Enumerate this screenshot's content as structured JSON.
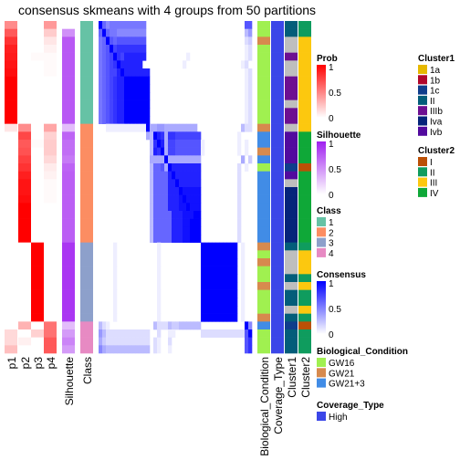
{
  "title": "consensus skmeans with 4 groups from 50 partitions",
  "chart_data": {
    "type": "heatmap",
    "title": "consensus skmeans with 4 groups from 50 partitions",
    "n_samples": 42,
    "consensus_scale": "0-15 hex digit per cell (value = digit/15)",
    "consensus_matrix": [
      "f978888888888000000000000000000000000000aab",
      "9f9887777777700000000000000000000000000046",
      "89fa9aaaaaaaa00000000000000000000000000023",
      "89afbcccccccc00000000000000000000000000012",
      "89abfcbdddddd00000000000100000000000000012",
      "89abcfdddddd00000000000100000000000000012",
      "89abbdfddddddd0000000000000000000000000012",
      "89abcddfffffff0000000000000000000000000012",
      "89abcddfffffff0000000000000000000000000012",
      "89abcddfffffff0000000000000000000000000012",
      "89abcddfffffff0000000000000000000000000012",
      "89abcddfffffff0000000000000000000000000012",
      "89abcddfffffff0000000000000000000000000012",
      "0011111111111f5566555555555000000000000422",
      "000000000000054fdc5ccbbbbbbb00000000001000",
      "000000000000004cfd5bbaaaaaaa10000000001010",
      "000000000000004dcf5bbaaaaaaa10000000001010",
      "000000000000005555f555555555000000000005033",
      "00000000000000499a5fdddddddd00000000002010",
      "0000000000000049999dfddddddd00000000002000",
      "0000000000000049999ddfdddddd00000000002000",
      "0000000000000049999dddfeeeee00000000002000",
      "0000000000000049999dddefeeee00000000002000",
      "0000000000000049999dddeefeee00000000002000",
      "00000000000000499999dddeeeff00000000002000",
      "00000000000000499999dddeefff00000000002000",
      "00000000000000499999dddeefff00000000002000",
      "00000000000000499999dddeefff00000000002000",
      "0000100000000000100000000000ffffffffff0100",
      "0000100000000000100000000000ffffffffff0100",
      "0000100000000000100000000000ffffffffff0100",
      "0000100000000000100000000000ffffffffff0100",
      "0000100000000000100000000000ffffffffff0100",
      "0000100000000000100000000000ffffffffff0100",
      "0000100000000000100000000000ffffffffff0100",
      "0000100000000000100000000000ffffffffff0100",
      "0000100000000000100000000000ffffffffff0100",
      "0000100000000000100000000000ffffffffff0100",
      "4210000000000004222433444444000000000000f799",
      "6422222222222200200110000000222222222222afbb",
      "5322222222222202100200000000000000000000acfc",
      "7544444444444402100100000000000000000000accf"
    ],
    "prob": {
      "columns": [
        "p1",
        "p2",
        "p3",
        "p4"
      ],
      "values": [
        [
          0.45,
          0,
          0,
          0.4
        ],
        [
          0.65,
          0,
          0,
          0.2
        ],
        [
          0.8,
          0,
          0,
          0.1
        ],
        [
          0.88,
          0,
          0,
          0.05
        ],
        [
          0.9,
          0,
          0.02,
          0.02
        ],
        [
          0.92,
          0,
          0,
          0.02
        ],
        [
          0.95,
          0,
          0,
          0.02
        ],
        [
          1,
          0,
          0,
          0
        ],
        [
          1,
          0,
          0,
          0
        ],
        [
          1,
          0,
          0,
          0
        ],
        [
          1,
          0,
          0,
          0
        ],
        [
          1,
          0,
          0,
          0
        ],
        [
          1,
          0,
          0,
          0
        ],
        [
          0.1,
          0.45,
          0,
          0.35
        ],
        [
          0,
          0.72,
          0,
          0.18
        ],
        [
          0,
          0.65,
          0.02,
          0.2
        ],
        [
          0,
          0.68,
          0,
          0.2
        ],
        [
          0,
          0.75,
          0,
          0.15
        ],
        [
          0,
          0.8,
          0,
          0.08
        ],
        [
          0,
          0.88,
          0,
          0.05
        ],
        [
          0,
          0.92,
          0,
          0.02
        ],
        [
          0,
          0.92,
          0,
          0.02
        ],
        [
          0,
          0.95,
          0,
          0.02
        ],
        [
          0,
          1,
          0,
          0
        ],
        [
          0,
          1,
          0,
          0
        ],
        [
          0,
          1,
          0,
          0
        ],
        [
          0,
          1,
          0,
          0
        ],
        [
          0,
          1,
          0,
          0
        ],
        [
          0,
          0,
          1,
          0
        ],
        [
          0,
          0,
          1,
          0
        ],
        [
          0,
          0,
          1,
          0
        ],
        [
          0,
          0,
          1,
          0
        ],
        [
          0,
          0,
          1,
          0
        ],
        [
          0,
          0,
          1,
          0
        ],
        [
          0,
          0,
          1,
          0
        ],
        [
          0,
          0,
          1,
          0
        ],
        [
          0,
          0,
          1,
          0
        ],
        [
          0,
          0,
          1,
          0
        ],
        [
          0,
          0.3,
          0,
          0.55
        ],
        [
          0.15,
          0,
          0.18,
          0.55
        ],
        [
          0.15,
          0.06,
          0,
          0.65
        ],
        [
          0.25,
          0,
          0,
          0.65
        ]
      ]
    },
    "silhouette": [
      0,
      0.5,
      0.75,
      0.75,
      0.75,
      0.75,
      0.75,
      0.75,
      0.75,
      0.75,
      0.75,
      0.75,
      0.75,
      0.3,
      0.7,
      0.65,
      0.65,
      0.6,
      0.7,
      0.72,
      0.72,
      0.72,
      0.72,
      0.72,
      0.72,
      0.72,
      0.72,
      0.72,
      0.9,
      0.9,
      0.9,
      0.9,
      0.9,
      0.9,
      0.9,
      0.9,
      0.9,
      0.9,
      0.3,
      0.45,
      0.55,
      0.45
    ],
    "class": [
      1,
      1,
      1,
      1,
      1,
      1,
      1,
      1,
      1,
      1,
      1,
      1,
      1,
      2,
      2,
      2,
      2,
      2,
      2,
      2,
      2,
      2,
      2,
      2,
      2,
      2,
      2,
      2,
      3,
      3,
      3,
      3,
      3,
      3,
      3,
      3,
      3,
      3,
      4,
      4,
      4,
      4
    ],
    "biological_condition": [
      "GW16",
      "GW16",
      "GW21",
      "GW16",
      "GW16",
      "GW16",
      "GW16",
      "GW16",
      "GW16",
      "GW16",
      "GW16",
      "GW16",
      "GW16",
      "GW21",
      "GW21+3",
      "GW21+3",
      "GW21",
      "GW21+3",
      "GW16",
      "GW21+3",
      "GW21+3",
      "GW21+3",
      "GW21+3",
      "GW21+3",
      "GW21+3",
      "GW21+3",
      "GW21+3",
      "GW21+3",
      "GW21",
      "GW16",
      "GW21",
      "GW16",
      "GW16",
      "GW21",
      "GW16",
      "GW16",
      "GW16",
      "GW21",
      "GW21+3",
      "GW16",
      "GW16",
      "GW16"
    ],
    "coverage_type": [
      "High",
      "High",
      "High",
      "High",
      "High",
      "High",
      "High",
      "High",
      "High",
      "High",
      "High",
      "High",
      "High",
      "High",
      "High",
      "High",
      "High",
      "High",
      "High",
      "High",
      "High",
      "High",
      "High",
      "High",
      "High",
      "High",
      "High",
      "High",
      "High",
      "High",
      "High",
      "High",
      "High",
      "High",
      "High",
      "High",
      "High",
      "High",
      "High",
      "High",
      "High",
      "High"
    ],
    "cluster1": [
      "II",
      "II",
      "NA",
      "NA",
      "IIIb",
      "NA",
      "NA",
      "IIIb",
      "IIIb",
      "IIIb",
      "NA",
      "IIIb",
      "IIIb",
      "NA",
      "Ivb",
      "Ivb",
      "Ivb",
      "Ivb",
      "1c",
      "Ivb",
      "NA",
      "Iva",
      "Iva",
      "Iva",
      "Iva",
      "Iva",
      "Iva",
      "Iva",
      "II",
      "NA",
      "NA",
      "NA",
      "II",
      "NA",
      "II",
      "II",
      "NA",
      "II",
      "1c",
      "II",
      "II",
      "II"
    ],
    "cluster2": [
      "II",
      "II",
      "III",
      "III",
      "III",
      "III",
      "III",
      "III",
      "III",
      "III",
      "III",
      "III",
      "III",
      "III",
      "IV",
      "IV",
      "IV",
      "IV",
      "I",
      "IV",
      "IV",
      "IV",
      "IV",
      "IV",
      "IV",
      "IV",
      "IV",
      "IV",
      "II",
      "III",
      "III",
      "III",
      "II",
      "III",
      "II",
      "II",
      "III",
      "II",
      "I",
      "II",
      "II",
      "II"
    ],
    "column_labels": [
      "p1",
      "p2",
      "p3",
      "p4",
      "Silhouette",
      "Class",
      "Biological_Condition",
      "Coverage_Type",
      "Cluster1",
      "Cluster2"
    ],
    "legends": [
      {
        "title": "Prob",
        "type": "continuous",
        "ticks": [
          "1",
          "0.5",
          "0"
        ],
        "color_low": "#ffffff",
        "color_high": "#ff0000"
      },
      {
        "title": "Silhouette",
        "type": "continuous",
        "ticks": [
          "1",
          "0.5",
          "0"
        ],
        "color_low": "#ffffff",
        "color_high": "#a020f0"
      },
      {
        "title": "Class",
        "type": "discrete",
        "items": [
          {
            "label": "1",
            "color": "#66c2a5"
          },
          {
            "label": "2",
            "color": "#fc8d62"
          },
          {
            "label": "3",
            "color": "#8da0cb"
          },
          {
            "label": "4",
            "color": "#e78ac3"
          }
        ]
      },
      {
        "title": "Consensus",
        "type": "continuous",
        "ticks": [
          "1",
          "0.5",
          "0"
        ],
        "color_low": "#ffffff",
        "color_high": "#0000ff"
      },
      {
        "title": "Biological_Condition",
        "type": "discrete",
        "items": [
          {
            "label": "GW16",
            "color": "#a0f050"
          },
          {
            "label": "GW21",
            "color": "#d78a4e"
          },
          {
            "label": "GW21+3",
            "color": "#418ce6"
          }
        ]
      },
      {
        "title": "Coverage_Type",
        "type": "discrete",
        "items": [
          {
            "label": "High",
            "color": "#3b46e8"
          }
        ]
      },
      {
        "title": "Cluster1",
        "type": "discrete",
        "items": [
          {
            "label": "1a",
            "color": "#e6b800"
          },
          {
            "label": "1b",
            "color": "#b0062b"
          },
          {
            "label": "1c",
            "color": "#0f3d8c"
          },
          {
            "label": "II",
            "color": "#035d7a"
          },
          {
            "label": "IIIb",
            "color": "#6d0f91"
          },
          {
            "label": "Iva",
            "color": "#05247a"
          },
          {
            "label": "Ivb",
            "color": "#520a9e"
          }
        ]
      },
      {
        "title": "Cluster2",
        "type": "discrete",
        "items": [
          {
            "label": "I",
            "color": "#bb5006"
          },
          {
            "label": "II",
            "color": "#0f9c5e"
          },
          {
            "label": "III",
            "color": "#fcc80f"
          },
          {
            "label": "IV",
            "color": "#0fa838"
          }
        ]
      }
    ],
    "na_color": "#bebebe"
  }
}
